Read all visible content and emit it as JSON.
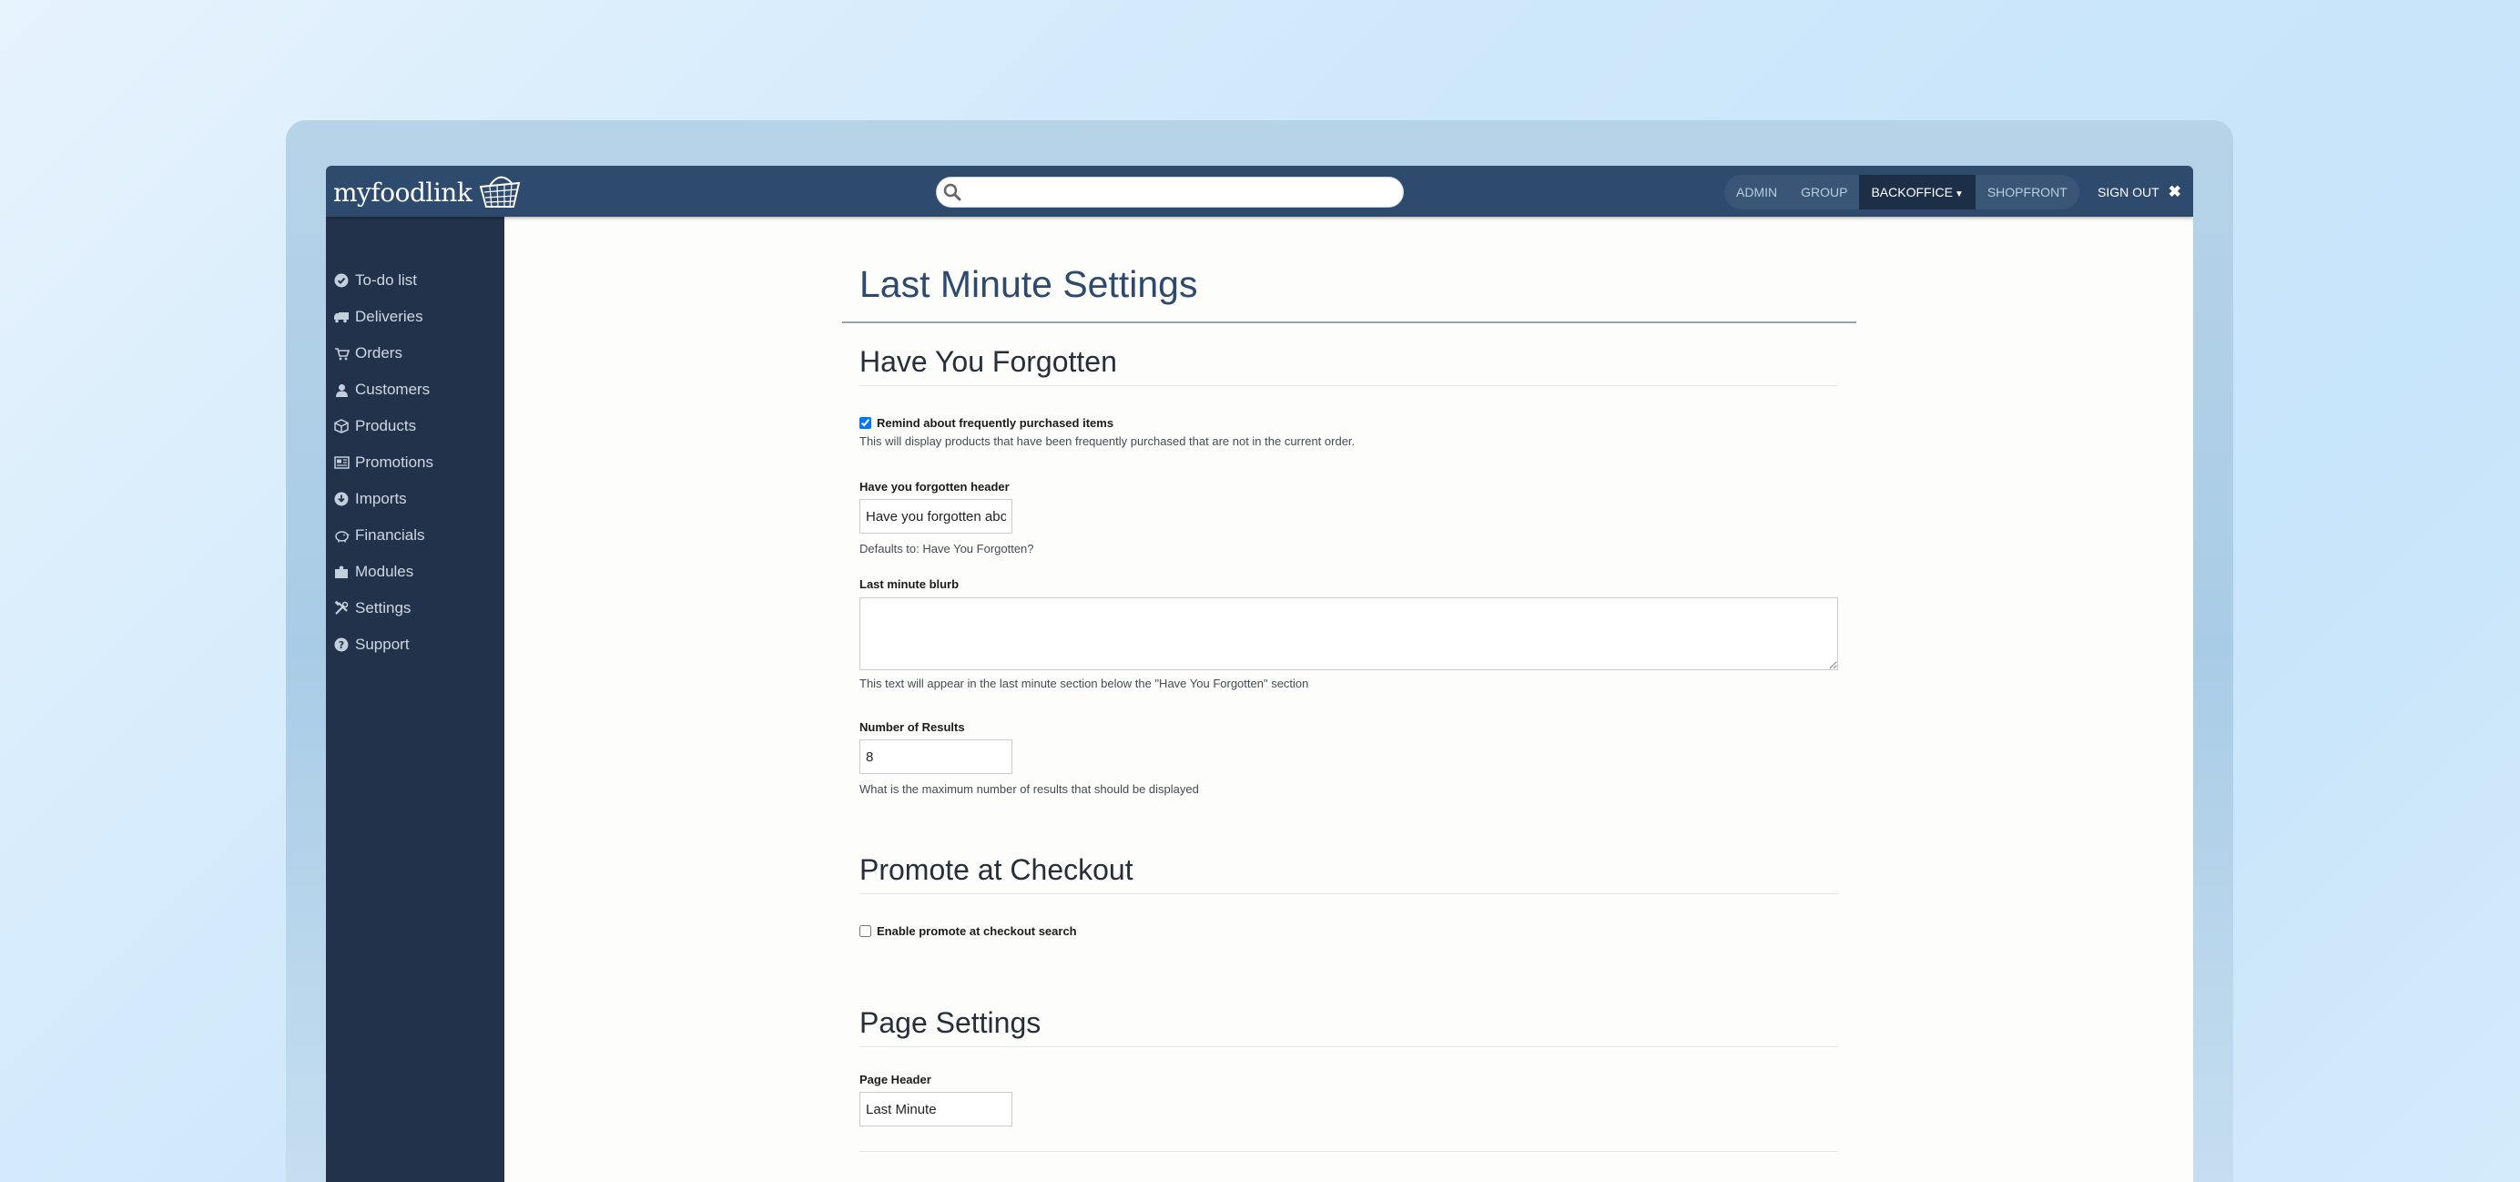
{
  "header": {
    "logo_text": "myfoodlink",
    "search": {
      "value": "",
      "placeholder": ""
    },
    "environments": [
      "ADMIN",
      "GROUP",
      "BACKOFFICE",
      "SHOPFRONT"
    ],
    "active_environment": "BACKOFFICE",
    "signout_label": "SIGN OUT"
  },
  "sidebar": {
    "items": [
      {
        "label": "To-do list",
        "icon": "check-circle-icon"
      },
      {
        "label": "Deliveries",
        "icon": "truck-icon"
      },
      {
        "label": "Orders",
        "icon": "cart-icon"
      },
      {
        "label": "Customers",
        "icon": "user-icon"
      },
      {
        "label": "Products",
        "icon": "box-icon"
      },
      {
        "label": "Promotions",
        "icon": "newspaper-icon"
      },
      {
        "label": "Imports",
        "icon": "download-circle-icon"
      },
      {
        "label": "Financials",
        "icon": "piggy-bank-icon"
      },
      {
        "label": "Modules",
        "icon": "puzzle-icon"
      },
      {
        "label": "Settings",
        "icon": "tools-icon"
      },
      {
        "label": "Support",
        "icon": "question-circle-icon"
      }
    ]
  },
  "main": {
    "title": "Last Minute Settings",
    "have_you_forgotten": {
      "heading": "Have You Forgotten",
      "remind_checkbox": {
        "label": "Remind about frequently purchased items",
        "checked": true
      },
      "remind_help": "This will display products that have been frequently purchased that are not in the current order.",
      "header_label": "Have you forgotten header",
      "header_value": "Have you forgotten about",
      "header_help": "Defaults to: Have You Forgotten?",
      "blurb_label": "Last minute blurb",
      "blurb_value": "",
      "blurb_help": "This text will appear in the last minute section below the \"Have You Forgotten\" section",
      "results_label": "Number of Results",
      "results_value": "8",
      "results_help": "What is the maximum number of results that should be displayed"
    },
    "promote_at_checkout": {
      "heading": "Promote at Checkout",
      "enable_checkbox": {
        "label": "Enable promote at checkout search",
        "checked": false
      }
    },
    "page_settings": {
      "heading": "Page Settings",
      "page_header_label": "Page Header",
      "page_header_value": "Last Minute"
    }
  },
  "colors": {
    "topbar": "#2e4a6d",
    "sidebar": "#22324a",
    "active_env": "#1d2f47",
    "title": "#2d4a6e"
  }
}
